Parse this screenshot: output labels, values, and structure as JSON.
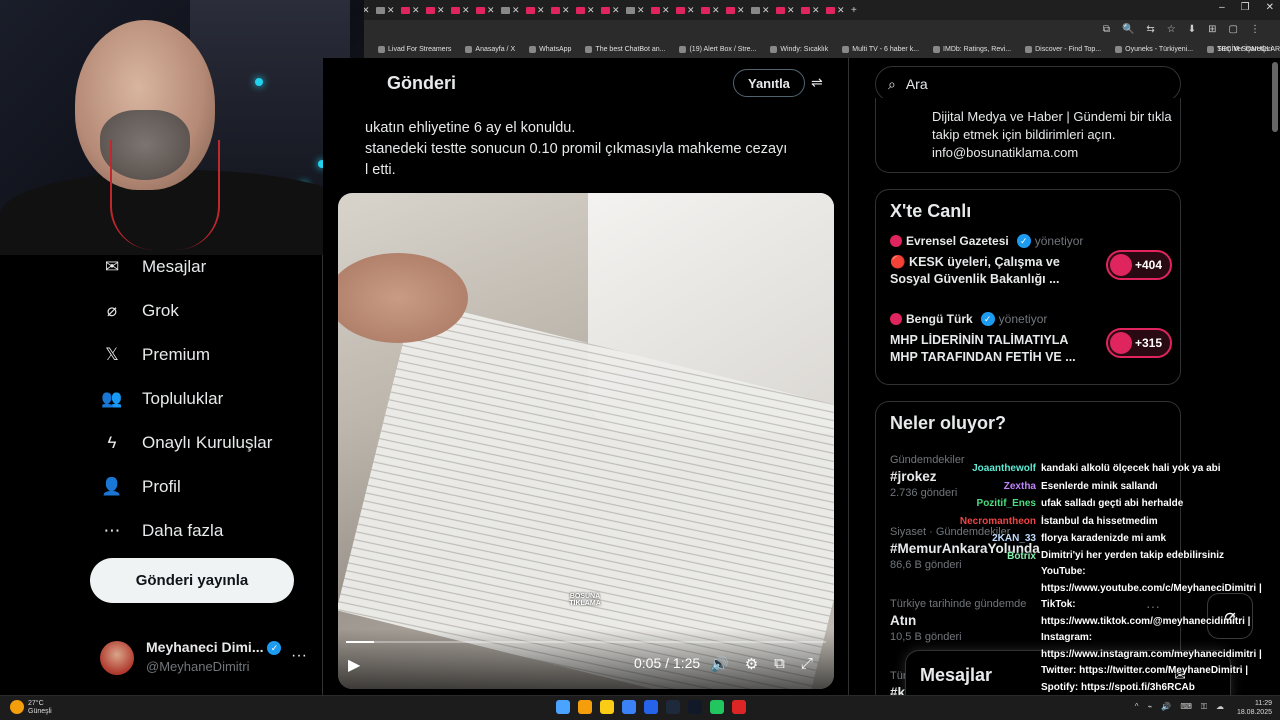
{
  "browser": {
    "tab_count": 34,
    "tab_close_glyph": "✕",
    "new_tab_glyph": "+",
    "window_controls": [
      "–",
      "❐",
      "✕"
    ],
    "toolbar_icons": [
      "⧉",
      "🔍",
      "⇆",
      "☆",
      "⬇",
      "⊞",
      "▢",
      "⋮"
    ],
    "bookmarks": [
      "Livad For Streamers",
      "Anasayfa / X",
      "WhatsApp",
      "The best ChatBot an...",
      "(19) Alert Box / Stre...",
      "Windy: Sıcaklık",
      "Multi TV - 6 haber k...",
      "IMDb: Ratings, Revi...",
      "Discover - Find Top...",
      "Oyuneks - Türkiyeni...",
      "SEÇİM SONUÇLARI...",
      "ChatGPT"
    ],
    "bookmarks_folder": "Tüm Yer İşaretleri"
  },
  "sidebar": {
    "items": [
      {
        "label": "Mesajlar",
        "icon": "envelope-icon",
        "glyph": "✉"
      },
      {
        "label": "Grok",
        "icon": "grok-icon",
        "glyph": "⌀"
      },
      {
        "label": "Premium",
        "icon": "x-logo-icon",
        "glyph": "𝕏"
      },
      {
        "label": "Topluluklar",
        "icon": "communities-icon",
        "glyph": "👥"
      },
      {
        "label": "Onaylı Kuruluşlar",
        "icon": "lightning-icon",
        "glyph": "ϟ"
      },
      {
        "label": "Profil",
        "icon": "person-icon",
        "glyph": "👤"
      },
      {
        "label": "Daha fazla",
        "icon": "more-circle-icon",
        "glyph": "⋯"
      }
    ],
    "post_button": "Gönderi yayınla",
    "profile": {
      "name": "Meyhaneci Dimi...",
      "handle": "@MeyhaneDimitri",
      "more": "···",
      "verified_glyph": "✓"
    }
  },
  "main": {
    "title": "Gönderi",
    "reply_button": "Yanıtla",
    "filter_glyph": "⇌",
    "tweet_lines": [
      "ukatın ehliyetine 6 ay el konuldu.",
      "stanedeki testte sonucun 0.10 promil çıkmasıyla mahkeme cezayı",
      "l etti."
    ],
    "video": {
      "watermark_line1": "BOŞUNA",
      "watermark_line2": "TIKLAMA",
      "time": "0:05 / 1:25",
      "progress": 0.059,
      "play_glyph": "▶",
      "control_glyphs": [
        "🔊",
        "⚙",
        "⧉",
        "⤢"
      ]
    }
  },
  "right": {
    "search_placeholder": "Ara",
    "search_glyph": "⌕",
    "promo_text": "Dijital Medya ve Haber | Gündemi bir tıkla takip etmek için bildirimleri açın. info@bosunatiklama.com",
    "live": {
      "title": "X'te Canlı",
      "items": [
        {
          "source": "Evrensel Gazetesi",
          "role": "yönetiyor",
          "headline": "🔴 KESK üyeleri, Çalışma ve Sosyal Güvenlik Bakanlığı ...",
          "count": "+404"
        },
        {
          "source": "Bengü Türk",
          "role": "yönetiyor",
          "headline": "MHP LİDERİNİN TALİMATIYLA MHP TARAFINDAN FETİH VE ...",
          "count": "+315"
        }
      ]
    },
    "trends": {
      "title": "Neler oluyor?",
      "items": [
        {
          "context": "Gündemdekiler",
          "tag": "#jrokez",
          "count": "2.736 gönderi"
        },
        {
          "context": "Siyaset · Gündemdekiler",
          "tag": "#MemurAnkaraYolunda",
          "count": "86,6 B gönderi"
        },
        {
          "context": "Türkiye tarihinde gündemde",
          "tag": "Atın",
          "count": "10,5 B gönderi"
        },
        {
          "context": "Tür",
          "tag": "#k",
          "count": ""
        }
      ],
      "more": "···"
    },
    "messages_drawer": "Mesajlar",
    "messages_drawer_glyph": "✉",
    "grok_glyph": "⌀"
  },
  "chat": {
    "messages": [
      {
        "user": "Joaanthewolf",
        "color": "#5eead4",
        "text": "kandaki alkolü ölçecek hali yok ya abi"
      },
      {
        "user": "Zextha",
        "color": "#c084fc",
        "text": "Esenlerde minik sallandı"
      },
      {
        "user": "Pozitif_Enes",
        "color": "#4ade80",
        "text": "ufak salladı geçti abi herhalde"
      },
      {
        "user": "Necromantheon",
        "color": "#ef4444",
        "text": "İstanbul da hissetmedim"
      },
      {
        "user": "2KAN_33",
        "color": "#bfdbfe",
        "text": "florya karadenizde mi amk"
      },
      {
        "user": "Botrix",
        "color": "#86efac",
        "lines": [
          "Dimitri'yi her yerden takip edebilirsiniz",
          "YouTube:",
          "https://www.youtube.com/c/MeyhaneciDimitri |",
          "TikTok:",
          "https://www.tiktok.com/@meyhanecidimitri |",
          "Instagram:",
          "https://www.instagram.com/meyhanecidimitri |",
          "Twitter: https://twitter.com/MeyhaneDimitri |",
          "Spotify: https://spoti.fi/3h6RCAb"
        ]
      }
    ]
  },
  "taskbar": {
    "weather_temp": "27°C",
    "weather_desc": "Güneşli",
    "time": "11:29",
    "date": "18.08.2025",
    "tray_glyphs": [
      "^",
      "⌁",
      "🔊",
      "⌨",
      "⚿",
      "☁"
    ],
    "app_colors": [
      "#4aa3ff",
      "#f59e0b",
      "#facc15",
      "#3b82f6",
      "#2563eb",
      "#1e293b",
      "#111827",
      "#22c55e",
      "#dc2626"
    ]
  },
  "colors": {
    "accent": "#1d9bf0",
    "live_red": "#e0245e",
    "background": "#000000"
  }
}
